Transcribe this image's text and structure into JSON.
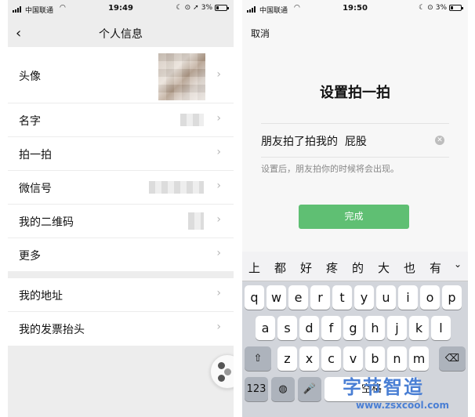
{
  "left_screen": {
    "status": {
      "carrier": "中国联通",
      "time": "19:49",
      "battery": "3%"
    },
    "nav_title": "个人信息",
    "rows_group1": [
      {
        "label": "头像"
      },
      {
        "label": "名字"
      },
      {
        "label": "拍一拍"
      },
      {
        "label": "微信号"
      },
      {
        "label": "我的二维码"
      },
      {
        "label": "更多"
      }
    ],
    "rows_group2": [
      {
        "label": "我的地址"
      },
      {
        "label": "我的发票抬头"
      }
    ]
  },
  "right_screen": {
    "status": {
      "carrier": "中国联通",
      "time": "19:50",
      "battery": "3%"
    },
    "cancel_label": "取消",
    "title": "设置拍一拍",
    "input_value": "朋友拍了拍我的  屁股",
    "hint": "设置后，朋友拍你的时候将会出现。",
    "done_label": "完成",
    "keyboard": {
      "candidates": [
        "上",
        "都",
        "好",
        "疼",
        "的",
        "大",
        "也",
        "有"
      ],
      "row1": [
        "q",
        "w",
        "e",
        "r",
        "t",
        "y",
        "u",
        "i",
        "o",
        "p"
      ],
      "row2": [
        "a",
        "s",
        "d",
        "f",
        "g",
        "h",
        "j",
        "k",
        "l"
      ],
      "row3": [
        "z",
        "x",
        "c",
        "v",
        "b",
        "n",
        "m"
      ],
      "numbers_key": "123",
      "space_label": "空格"
    }
  },
  "watermark": {
    "text": "字节智造",
    "url": "www.zsxcool.com"
  }
}
